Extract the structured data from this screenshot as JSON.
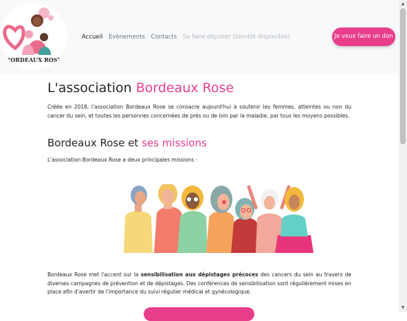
{
  "header": {
    "logo_text": "BORDEAUX ROSE",
    "nav": [
      {
        "label": "Accueil"
      },
      {
        "label": "Evènements"
      },
      {
        "label": "Contacts"
      },
      {
        "label": "Se faire dépister (bientôt disponible)"
      }
    ],
    "donate_label": "Je veux faire un don"
  },
  "main": {
    "title_part1": "L'association ",
    "title_part2": "Bordeaux Rose",
    "intro": "Créée en 2018, l'association Bordeaux Rose se consacre aujourd'hui à soutenir les femmes, atteintes ou non du cancer du sein, et toutes les personnes concernées de près ou de loin par la maladie, par tous les moyens possibles.",
    "missions_title_part1": "Bordeaux Rose et ",
    "missions_title_part2": "ses missions",
    "missions_intro": "L'association Bordeaux Rose a deux principales missions :",
    "mission1_pre": "Bordeaux Rose met l'accent sur la ",
    "mission1_bold": "sensibilisation aux dépistages précoces",
    "mission1_post": " des cancers du sein au travers de diverses campagnes de prévention et de dépistages. Des conférences de sensibilisation sont régulièrement mises en place afin d'avertir de l'importance du suivi régulier médical et gynécologique."
  },
  "colors": {
    "accent": "#e83e8c",
    "header_bg": "#f8f9fa"
  }
}
